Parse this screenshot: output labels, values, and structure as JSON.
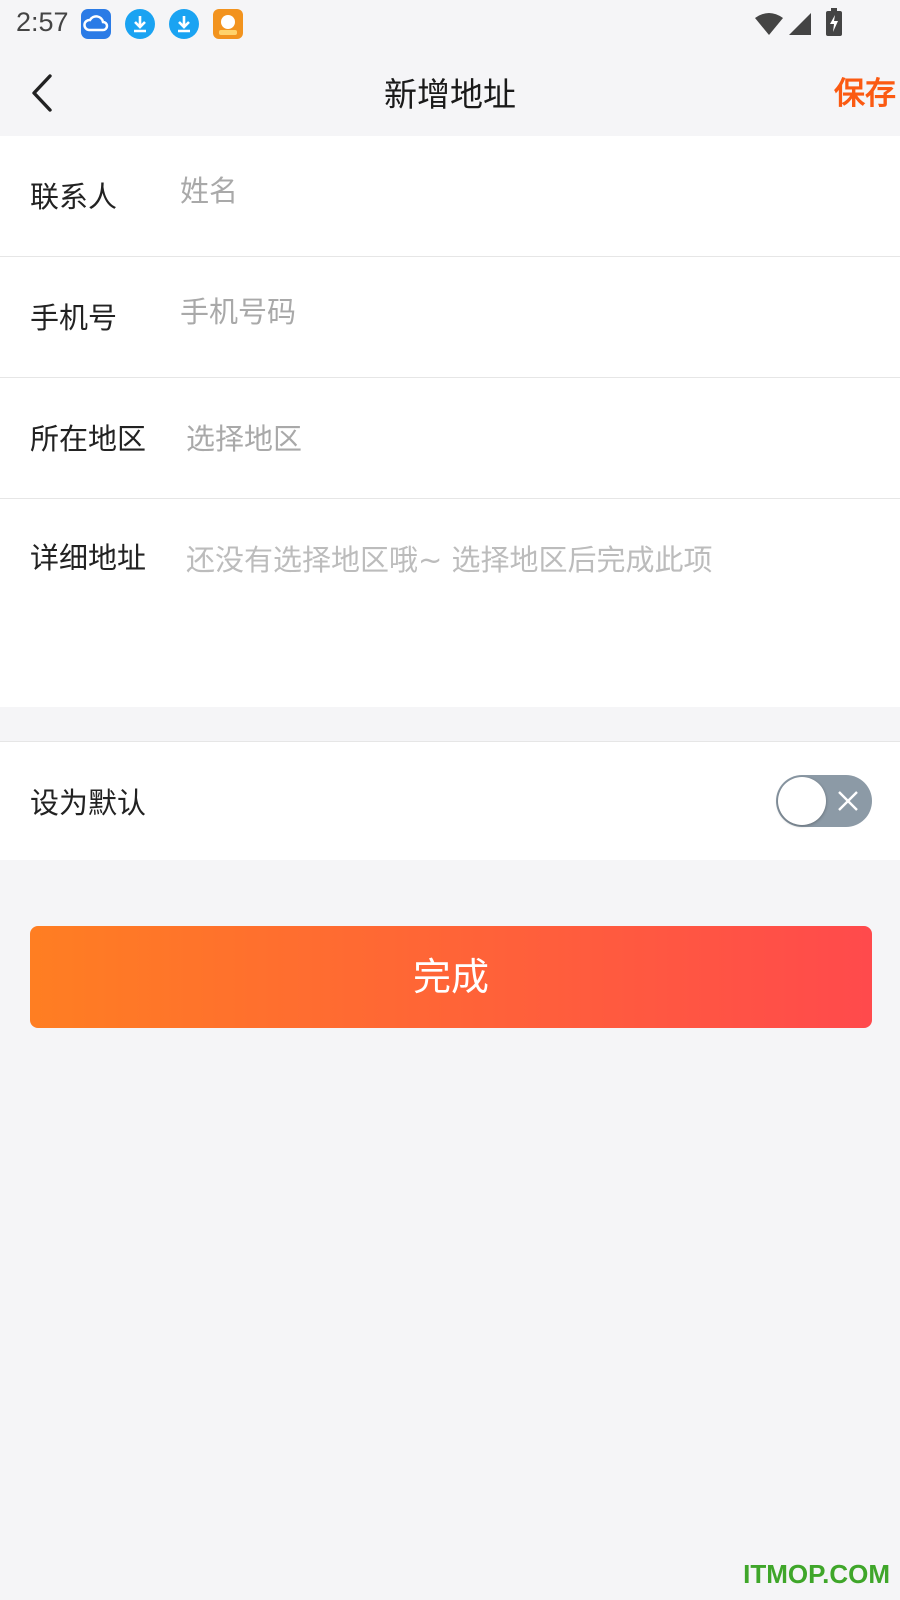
{
  "statusbar": {
    "time": "2:57",
    "icons": [
      "cloud-app-icon",
      "download-icon",
      "download-icon",
      "app-icon",
      "wifi-icon",
      "signal-icon",
      "battery-icon"
    ]
  },
  "navbar": {
    "back_icon": "chevron-left-icon",
    "title": "新增地址",
    "save_label": "保存"
  },
  "form": {
    "contact_label": "联系人",
    "contact_placeholder": "姓名",
    "contact_value": "",
    "phone_label": "手机号",
    "phone_placeholder": "手机号码",
    "phone_value": "",
    "region_label": "所在地区",
    "region_placeholder": "选择地区",
    "detail_label": "详细地址",
    "detail_placeholder": "还没有选择地区哦~ 选择地区后完成此项"
  },
  "default_setting": {
    "label": "设为默认",
    "enabled": false
  },
  "done_label": "完成",
  "watermark": "ITMOP.COM",
  "colors": {
    "accent": "#fb5a12",
    "button_gradient_start": "#ff7e22",
    "button_gradient_end": "#ff4a4c",
    "toggle_off": "#8c9aa6"
  }
}
